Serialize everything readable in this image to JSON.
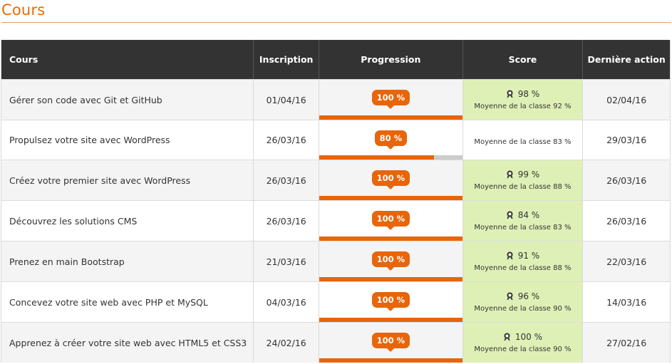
{
  "page": {
    "title": "Cours"
  },
  "colors": {
    "accent": "#e8650a",
    "header_bg": "#333333",
    "score_highlight": "#dff0b6"
  },
  "table": {
    "headers": {
      "course": "Cours",
      "inscription": "Inscription",
      "progression": "Progression",
      "score": "Score",
      "last_action": "Dernière action"
    },
    "rows": [
      {
        "course": "Gérer son code avec Git et GitHub",
        "inscription": "01/04/16",
        "progress_label": "100 %",
        "progress": 1.0,
        "score": "98 %",
        "average": "Moyenne de la classe 92 %",
        "score_highlight": true,
        "medal_icon": "medal-icon",
        "last_action": "02/04/16"
      },
      {
        "course": "Propulsez votre site avec WordPress",
        "inscription": "26/03/16",
        "progress_label": "80 %",
        "progress": 0.8,
        "score": "",
        "average": "Moyenne de la classe 83 %",
        "score_highlight": false,
        "last_action": "29/03/16"
      },
      {
        "course": "Créez votre premier site avec WordPress",
        "inscription": "26/03/16",
        "progress_label": "100 %",
        "progress": 1.0,
        "score": "99 %",
        "average": "Moyenne de la classe 88 %",
        "score_highlight": true,
        "medal_icon": "medal-icon",
        "last_action": "26/03/16"
      },
      {
        "course": "Découvrez les solutions CMS",
        "inscription": "26/03/16",
        "progress_label": "100 %",
        "progress": 1.0,
        "score": "84 %",
        "average": "Moyenne de la classe 83 %",
        "score_highlight": true,
        "medal_icon": "medal-icon",
        "last_action": "26/03/16"
      },
      {
        "course": "Prenez en main Bootstrap",
        "inscription": "21/03/16",
        "progress_label": "100 %",
        "progress": 1.0,
        "score": "91 %",
        "average": "Moyenne de la classe 88 %",
        "score_highlight": true,
        "medal_icon": "medal-icon",
        "last_action": "22/03/16"
      },
      {
        "course": "Concevez votre site web avec PHP et MySQL",
        "inscription": "04/03/16",
        "progress_label": "100 %",
        "progress": 1.0,
        "score": "96 %",
        "average": "Moyenne de la classe 90 %",
        "score_highlight": true,
        "medal_icon": "medal-icon",
        "last_action": "14/03/16"
      },
      {
        "course": "Apprenez à créer votre site web avec HTML5 et CSS3",
        "inscription": "24/02/16",
        "progress_label": "100 %",
        "progress": 1.0,
        "score": "100 %",
        "average": "Moyenne de la classe 90 %",
        "score_highlight": true,
        "medal_icon": "medal-icon",
        "last_action": "27/02/16"
      }
    ]
  }
}
